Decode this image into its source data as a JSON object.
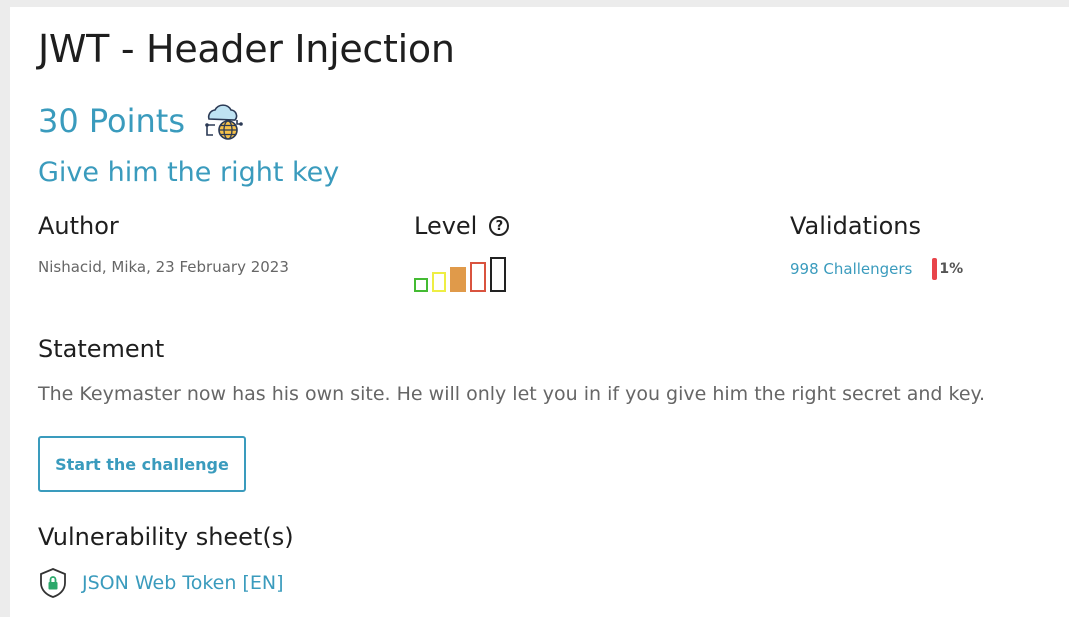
{
  "challenge": {
    "title": "JWT - Header Injection",
    "points": "30 Points",
    "category_icon": "cloud-globe-icon",
    "subtitle": "Give him the right key"
  },
  "author": {
    "heading": "Author",
    "line": "Nishacid, Mika,  23 February 2023"
  },
  "level": {
    "heading": "Level",
    "help_icon": "question-circle-icon",
    "help_glyph": "?",
    "value": 3,
    "max": 5,
    "colors": [
      "#44bb33",
      "#eeee44",
      "#e09a4a",
      "#d9533f",
      "#222222"
    ]
  },
  "validations": {
    "heading": "Validations",
    "challengers": "998 Challengers",
    "rate": "1%",
    "rate_color": "#e8444a"
  },
  "statement": {
    "heading": "Statement",
    "text": "The Keymaster now has his own site. He will only let you in if you give him the right secret and key."
  },
  "actions": {
    "start_label": "Start the challenge"
  },
  "vulnerability": {
    "heading": "Vulnerability sheet(s)",
    "items": [
      {
        "label": "JSON Web Token [EN]",
        "icon": "shield-lock-icon"
      }
    ]
  },
  "colors": {
    "accent": "#3a9bbd",
    "background": "#ececec",
    "panel": "#ffffff"
  }
}
